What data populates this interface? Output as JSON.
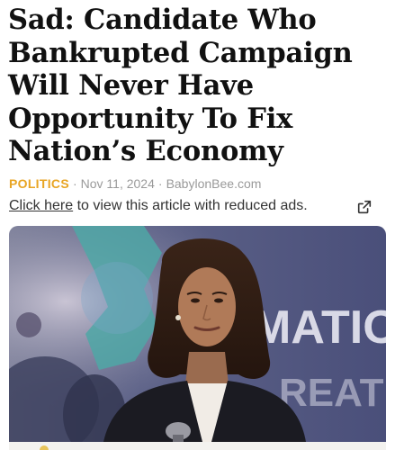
{
  "article": {
    "headline_lines": [
      "Sad: Candidate Who",
      "Bankrupted Campaign",
      "Will Never Have",
      "Opportunity To Fix",
      "Nation’s Economy"
    ],
    "category": "POLITICS",
    "date": "Nov 11, 2024",
    "source": "BabylonBee.com",
    "separator": "·"
  },
  "reduced_ads": {
    "link_text": "Click here",
    "rest_text": " to view this article with reduced ads."
  },
  "hero_image": {
    "background_sign_text": "MATIO",
    "background_sign_text_2": "REAT"
  },
  "icons": {
    "external_link": "external-link-icon"
  },
  "colors": {
    "category": "#e8a524",
    "headline": "#111111",
    "meta": "#9a9a9a"
  }
}
